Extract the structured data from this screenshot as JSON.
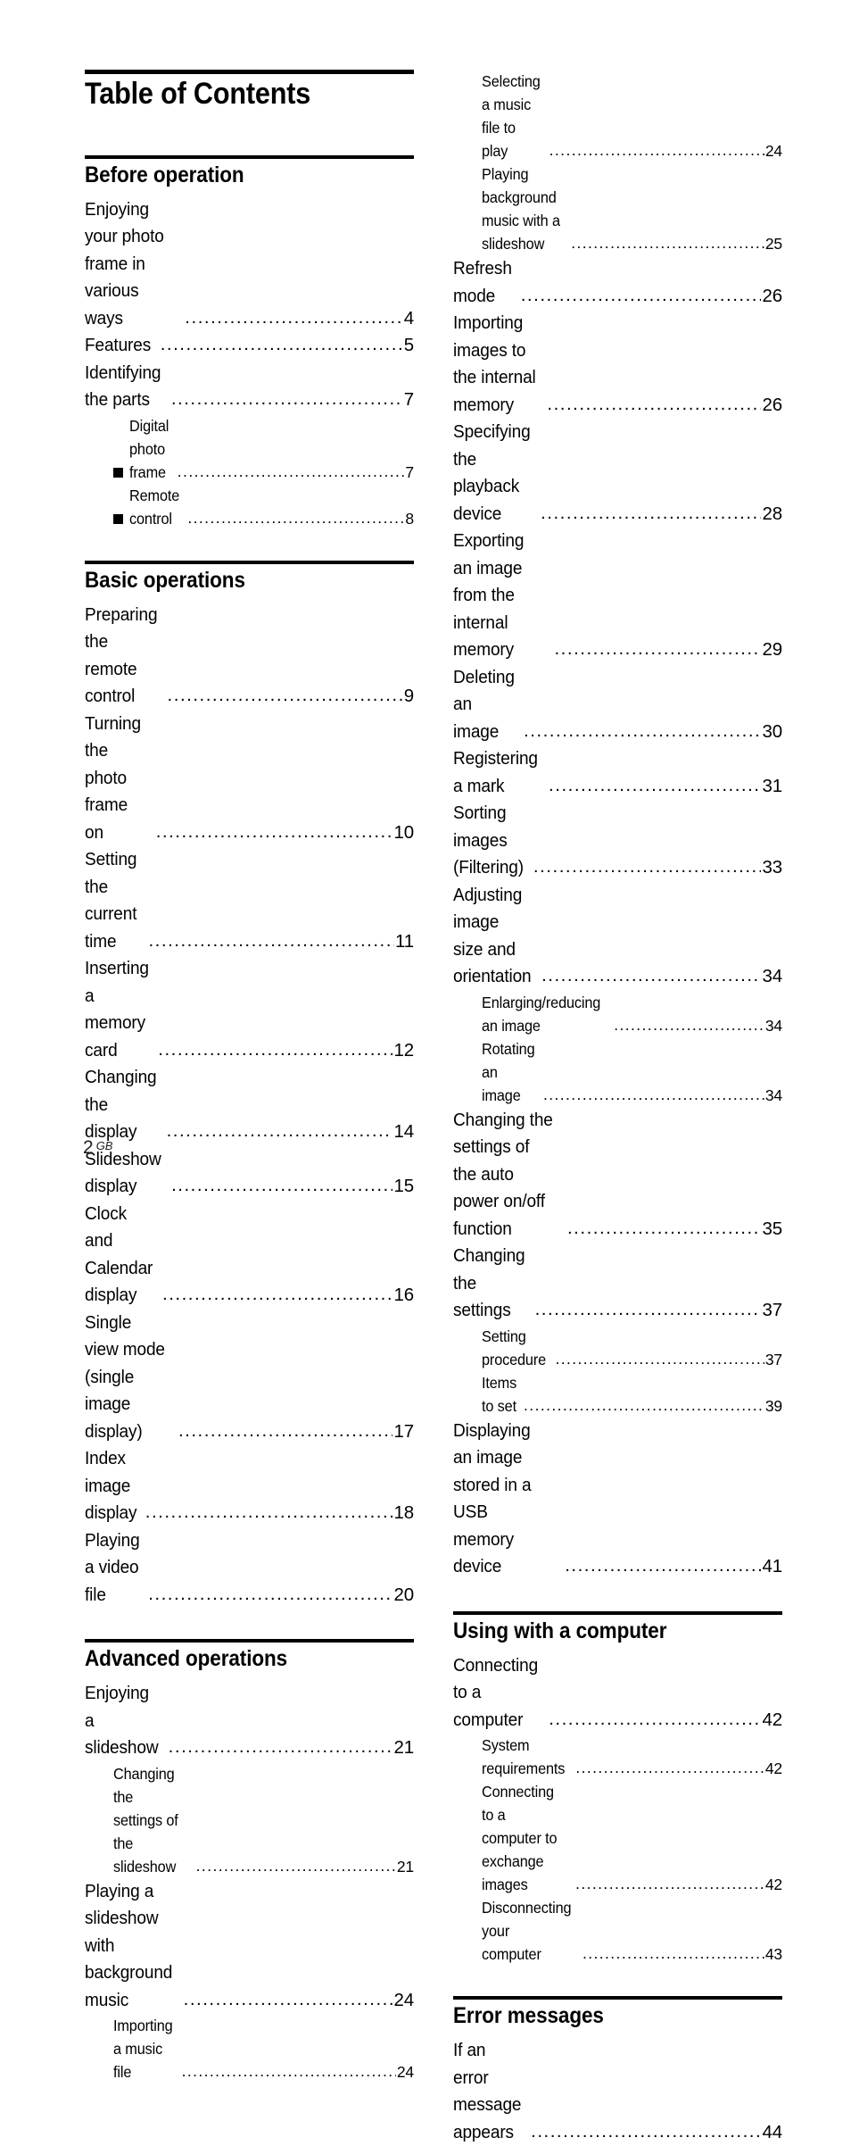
{
  "document": {
    "title": "Table of Contents",
    "footer": {
      "page_number": "2",
      "region_code": "GB"
    }
  },
  "columns": {
    "left": [
      {
        "heading": "Before operation",
        "entries": [
          {
            "level": 1,
            "bullet": false,
            "label": "Enjoying your photo frame in various ways",
            "page": "4"
          },
          {
            "level": 1,
            "bullet": false,
            "label": "Features",
            "page": "5"
          },
          {
            "level": 1,
            "bullet": false,
            "label": "Identifying the parts",
            "page": "7"
          },
          {
            "level": 2,
            "bullet": true,
            "label": "Digital photo frame",
            "page": "7"
          },
          {
            "level": 2,
            "bullet": true,
            "label": "Remote control",
            "page": "8"
          }
        ]
      },
      {
        "heading": "Basic operations",
        "entries": [
          {
            "level": 1,
            "bullet": false,
            "label": "Preparing the remote control",
            "page": "9"
          },
          {
            "level": 1,
            "bullet": false,
            "label": "Turning the photo frame on",
            "page": "10"
          },
          {
            "level": 1,
            "bullet": false,
            "label": "Setting the current time",
            "page": "11"
          },
          {
            "level": 1,
            "bullet": false,
            "label": "Inserting a memory card",
            "page": "12"
          },
          {
            "level": 1,
            "bullet": false,
            "label": "Changing the display",
            "page": "14"
          },
          {
            "level": 1,
            "bullet": false,
            "label": "Slideshow display",
            "page": "15"
          },
          {
            "level": 1,
            "bullet": false,
            "label": "Clock and Calendar display",
            "page": "16"
          },
          {
            "level": 1,
            "bullet": false,
            "label": "Single view mode (single image display)",
            "page": "17"
          },
          {
            "level": 1,
            "bullet": false,
            "label": "Index image display",
            "page": "18"
          },
          {
            "level": 1,
            "bullet": false,
            "label": "Playing a video file",
            "page": "20"
          }
        ]
      },
      {
        "heading": "Advanced operations",
        "entries": [
          {
            "level": 1,
            "bullet": false,
            "label": "Enjoying a slideshow",
            "page": "21"
          },
          {
            "level": 2,
            "bullet": false,
            "label": "Changing the settings of the slideshow",
            "page": "21"
          },
          {
            "level": 1,
            "bullet": false,
            "label": "Playing a slideshow with background music",
            "page": "24"
          },
          {
            "level": 2,
            "bullet": false,
            "label": "Importing a music file",
            "page": "24"
          }
        ]
      }
    ],
    "right": [
      {
        "heading": null,
        "entries": [
          {
            "level": 2,
            "bullet": false,
            "label": "Selecting a music file to play",
            "page": "24"
          },
          {
            "level": 2,
            "bullet": false,
            "label": "Playing background music with a slideshow",
            "page": "25"
          },
          {
            "level": 1,
            "bullet": false,
            "label": "Refresh mode",
            "page": "26"
          },
          {
            "level": 1,
            "bullet": false,
            "label": "Importing images to the internal memory",
            "page": "26"
          },
          {
            "level": 1,
            "bullet": false,
            "label": "Specifying the playback device",
            "page": "28"
          },
          {
            "level": 1,
            "bullet": false,
            "label": "Exporting an image from the internal memory",
            "page": "29"
          },
          {
            "level": 1,
            "bullet": false,
            "label": "Deleting an image",
            "page": "30"
          },
          {
            "level": 1,
            "bullet": false,
            "label": "Registering a mark",
            "page": "31"
          },
          {
            "level": 1,
            "bullet": false,
            "label": "Sorting images (Filtering)",
            "page": "33"
          },
          {
            "level": 1,
            "bullet": false,
            "label": "Adjusting image size and orientation",
            "page": "34"
          },
          {
            "level": 2,
            "bullet": false,
            "label": "Enlarging/reducing an image",
            "page": "34"
          },
          {
            "level": 2,
            "bullet": false,
            "label": "Rotating an image",
            "page": "34"
          },
          {
            "level": 1,
            "bullet": false,
            "label": "Changing the settings of the auto power on/off function",
            "page": "35"
          },
          {
            "level": 1,
            "bullet": false,
            "label": "Changing the settings",
            "page": "37"
          },
          {
            "level": 2,
            "bullet": false,
            "label": "Setting procedure",
            "page": "37"
          },
          {
            "level": 2,
            "bullet": false,
            "label": "Items to set",
            "page": "39"
          },
          {
            "level": 1,
            "bullet": false,
            "label": "Displaying an image stored in a USB memory device",
            "page": "41"
          }
        ]
      },
      {
        "heading": "Using with a computer",
        "entries": [
          {
            "level": 1,
            "bullet": false,
            "label": "Connecting to a computer",
            "page": "42"
          },
          {
            "level": 2,
            "bullet": false,
            "label": "System requirements",
            "page": "42"
          },
          {
            "level": 2,
            "bullet": false,
            "label": "Connecting to a computer to exchange images",
            "page": "42"
          },
          {
            "level": 2,
            "bullet": false,
            "label": "Disconnecting your computer",
            "page": "43"
          }
        ]
      },
      {
        "heading": "Error messages",
        "entries": [
          {
            "level": 1,
            "bullet": false,
            "label": "If an error message appears",
            "page": "44"
          }
        ]
      }
    ]
  }
}
